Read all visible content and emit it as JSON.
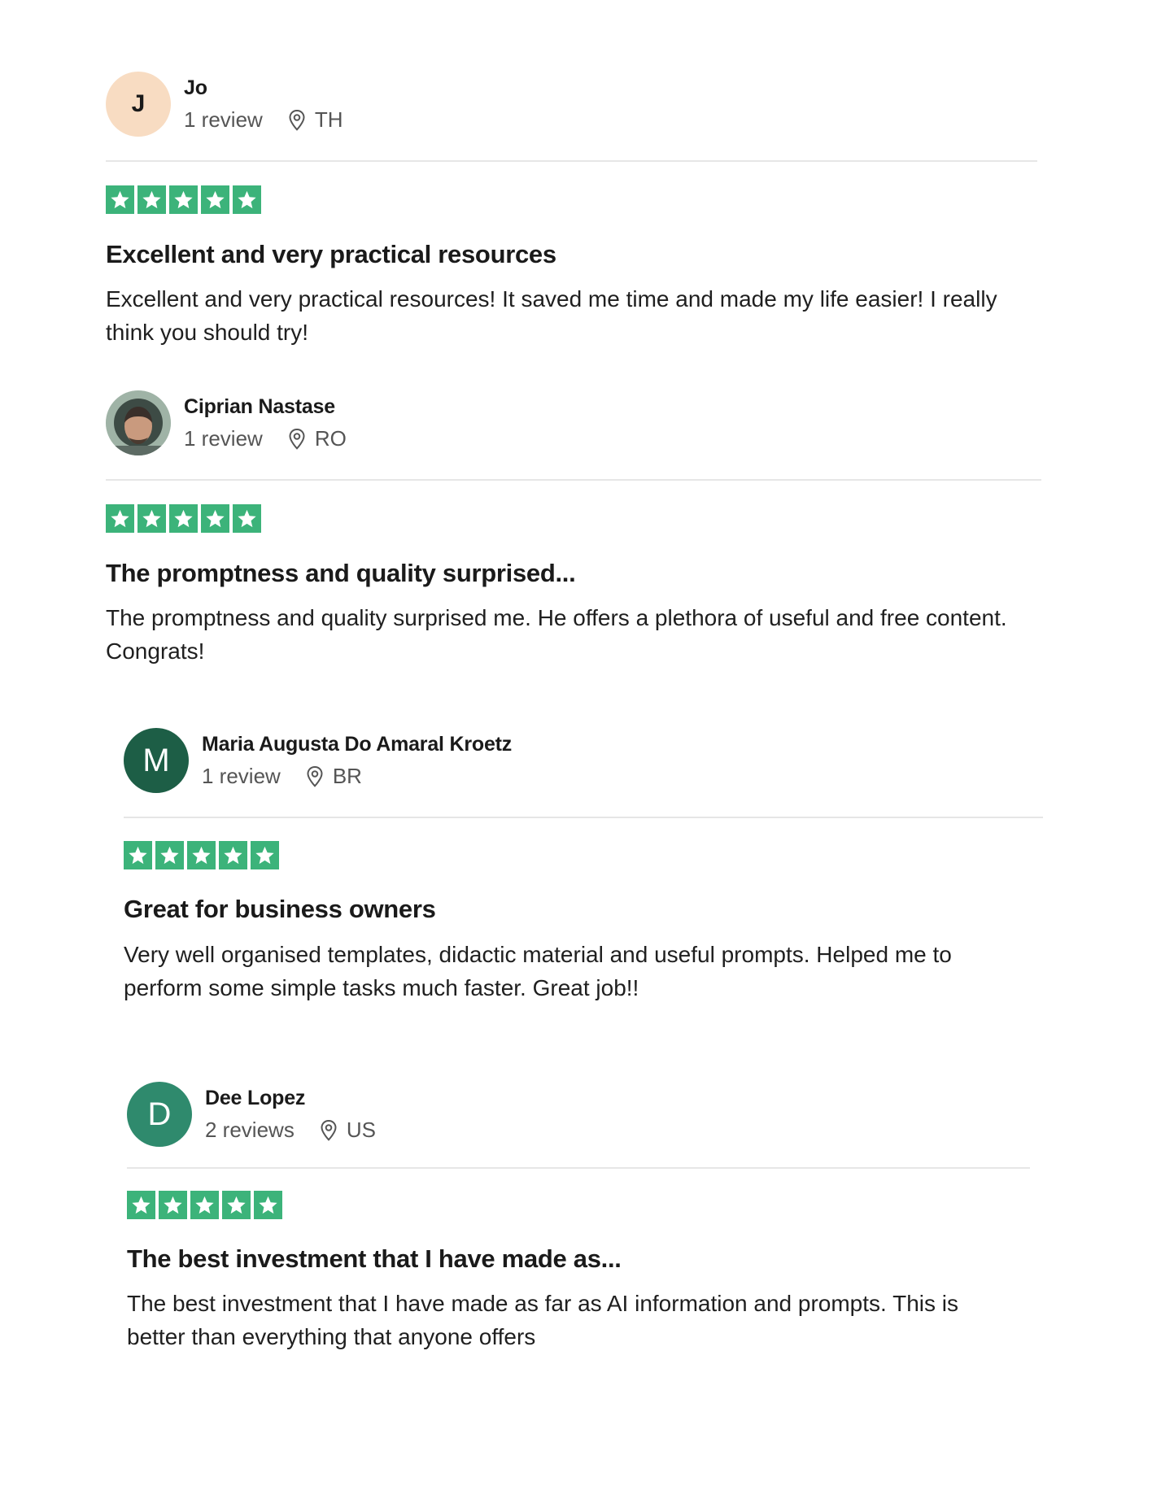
{
  "colors": {
    "star_green": "#3cb37a",
    "divider": "#e6e6e6",
    "meta_gray": "#555555"
  },
  "reviews": [
    {
      "avatar": {
        "type": "initial",
        "text": "J"
      },
      "name": "Jo",
      "review_count": "1 review",
      "location": "TH",
      "rating": 5,
      "title": "Excellent and very practical resources",
      "body": "Excellent and very practical resources! It saved me time and made my life easier! I really think you should try!"
    },
    {
      "avatar": {
        "type": "photo",
        "icon": "person-photo-icon"
      },
      "name": "Ciprian Nastase",
      "review_count": "1 review",
      "location": "RO",
      "rating": 5,
      "title": "The promptness and quality surprised...",
      "body": "The promptness and quality surprised me. He offers a plethora of useful and free content. Congrats!"
    },
    {
      "avatar": {
        "type": "initial",
        "text": "M"
      },
      "name": "Maria Augusta Do Amaral Kroetz",
      "review_count": "1 review",
      "location": "BR",
      "rating": 5,
      "title": "Great for business owners",
      "body": "Very well organised templates, didactic material and useful prompts. Helped me to perform some simple tasks much faster. Great job!!"
    },
    {
      "avatar": {
        "type": "initial",
        "text": "D"
      },
      "name": "Dee Lopez",
      "review_count": "2 reviews",
      "location": "US",
      "rating": 5,
      "title": "The best investment that I have made as...",
      "body": "The best investment that I have made as far as AI information and prompts. This is better than everything that anyone offers"
    }
  ]
}
